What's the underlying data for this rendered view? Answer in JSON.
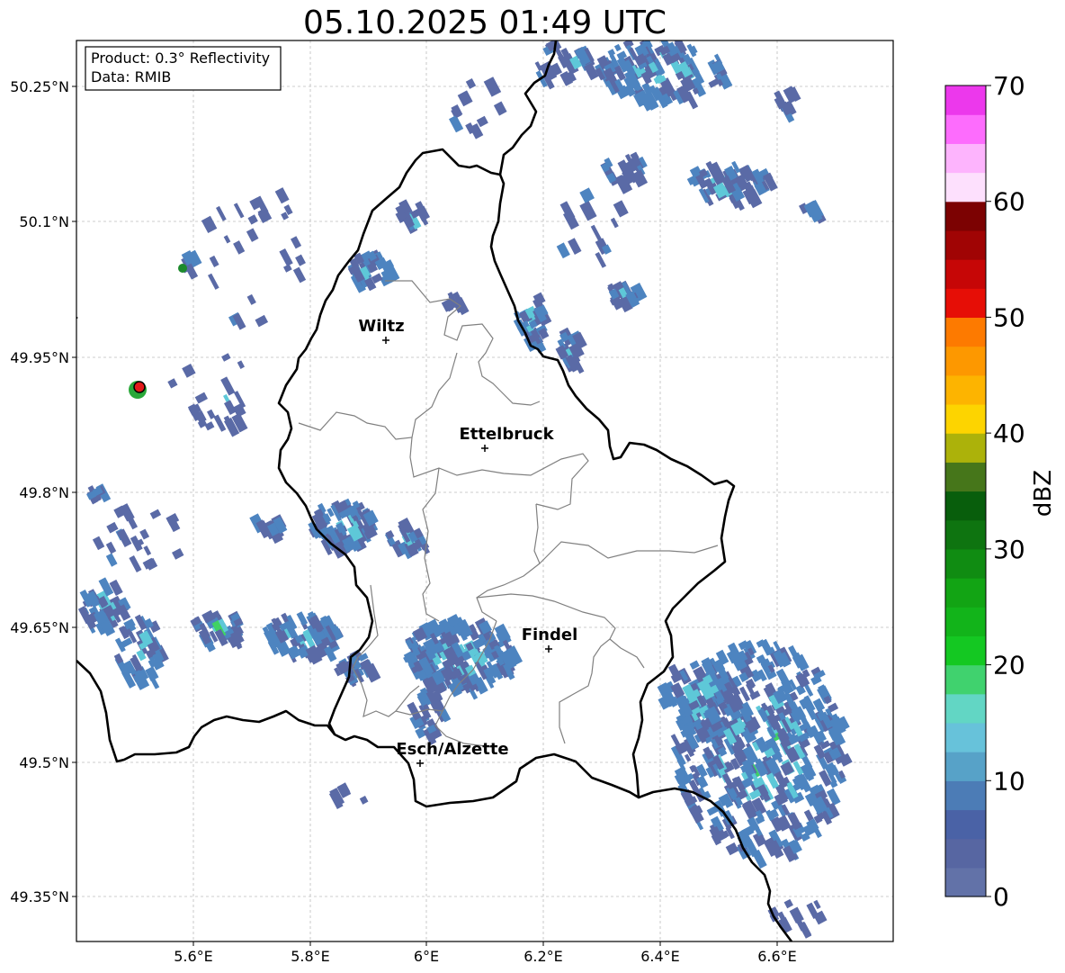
{
  "title": "05.10.2025 01:49 UTC",
  "info": {
    "product": "Product: 0.3° Reflectivity",
    "data": "Data: RMIB"
  },
  "lat_labels": [
    "50.25°N",
    "50.1°N",
    "49.95°N",
    "49.8°N",
    "49.65°N",
    "49.5°N",
    "49.35°N"
  ],
  "lon_labels": [
    "5.6°E",
    "5.8°E",
    "6°E",
    "6.2°E",
    "6.4°E",
    "6.6°E"
  ],
  "cities": [
    {
      "name": "Wiltz"
    },
    {
      "name": "Ettelbruck"
    },
    {
      "name": "Findel"
    },
    {
      "name": "Esch/Alzette"
    }
  ],
  "colorbar": {
    "label": "dBZ",
    "min": 0,
    "max": 70,
    "ticks": [
      "0",
      "10",
      "20",
      "30",
      "40",
      "50",
      "60",
      "70"
    ],
    "colors": [
      "#6272a8",
      "#5766a2",
      "#4a62a6",
      "#4c7cb6",
      "#57a2c8",
      "#67c2da",
      "#62d6c4",
      "#40d26e",
      "#14c822",
      "#12b41a",
      "#12a414",
      "#108c12",
      "#0e7410",
      "#085e0c",
      "#46761a",
      "#acb20a",
      "#fdd400",
      "#fdb400",
      "#fd9800",
      "#fd7a00",
      "#e60e06",
      "#c60606",
      "#a00404",
      "#7c0202",
      "#fde0fd",
      "#fdb4fd",
      "#fd6cfd",
      "#ec38ec"
    ]
  },
  "radar_site_color": "#e21a1a",
  "echo_colors": {
    "low": "#5a6aa6",
    "mid": "#4d84c0",
    "cyan": "#5ec8d8",
    "green": "#3fd264"
  }
}
